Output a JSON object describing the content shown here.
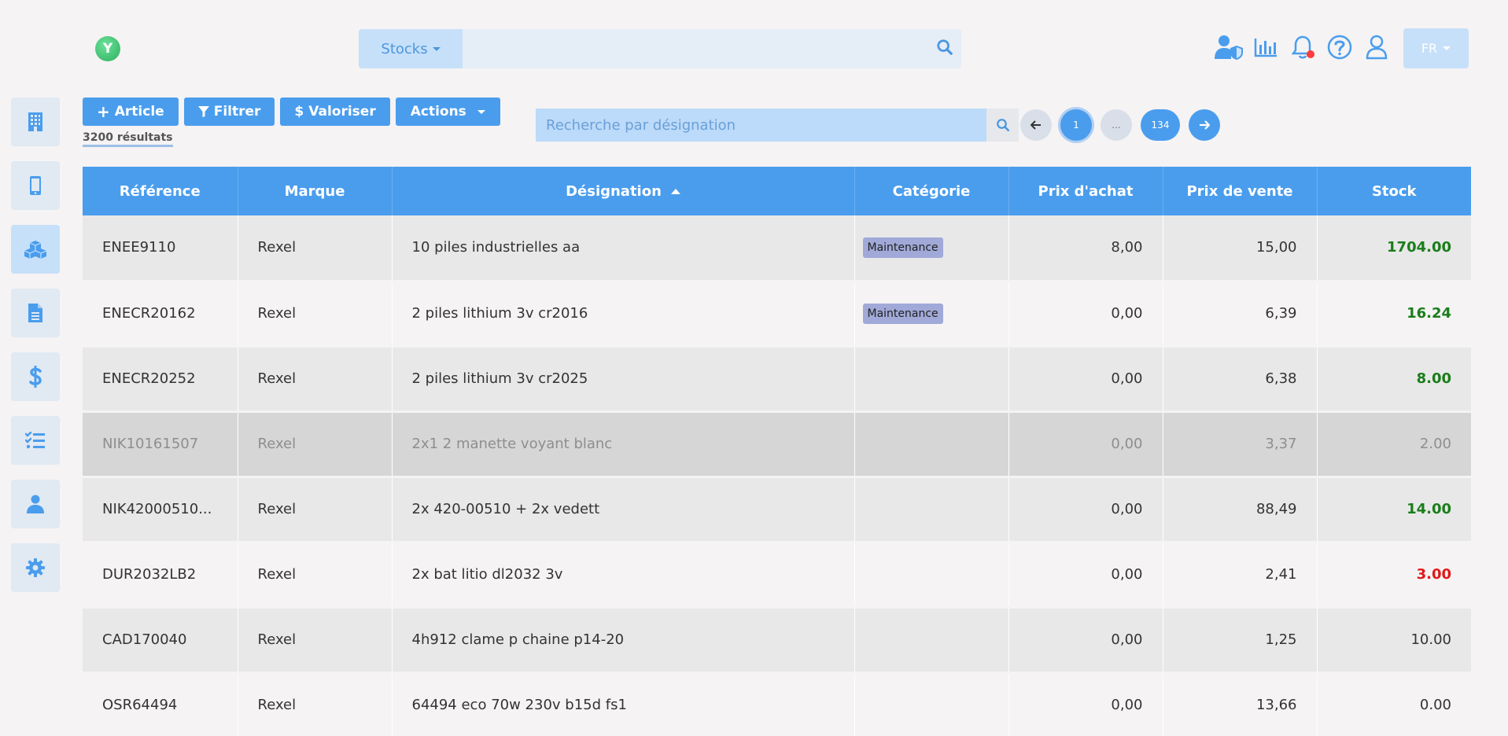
{
  "header": {
    "logo_letter": "Y",
    "module_select": "Stocks",
    "lang": "FR"
  },
  "toolbar": {
    "article_label": "Article",
    "filter_label": "Filtrer",
    "valorize_label": "Valoriser",
    "actions_label": "Actions",
    "results": "3200 résultats"
  },
  "search": {
    "placeholder": "Recherche par désignation"
  },
  "pagination": {
    "current": "1",
    "ellipsis": "...",
    "last": "134"
  },
  "table": {
    "headers": {
      "reference": "Référence",
      "brand": "Marque",
      "designation": "Désignation",
      "category": "Catégorie",
      "purchase_price": "Prix d'achat",
      "sale_price": "Prix de vente",
      "stock": "Stock"
    },
    "rows": [
      {
        "ref": "ENEE9110",
        "brand": "Rexel",
        "designation": "10 piles industrielles aa",
        "category": "Maintenance",
        "purchase": "8,00",
        "sale": "15,00",
        "stock": "1704.00"
      },
      {
        "ref": "ENECR20162",
        "brand": "Rexel",
        "designation": "2 piles lithium 3v cr2016",
        "category": "Maintenance",
        "purchase": "0,00",
        "sale": "6,39",
        "stock": "16.24"
      },
      {
        "ref": "ENECR20252",
        "brand": "Rexel",
        "designation": "2 piles lithium 3v cr2025",
        "category": "",
        "purchase": "0,00",
        "sale": "6,38",
        "stock": "8.00"
      },
      {
        "ref": "NIK10161507",
        "brand": "Rexel",
        "designation": "2x1 2 manette voyant blanc",
        "category": "",
        "purchase": "0,00",
        "sale": "3,37",
        "stock": "2.00"
      },
      {
        "ref": "NIK42000510...",
        "brand": "Rexel",
        "designation": "2x 420-00510 + 2x vedett",
        "category": "",
        "purchase": "0,00",
        "sale": "88,49",
        "stock": "14.00"
      },
      {
        "ref": "DUR2032LB2",
        "brand": "Rexel",
        "designation": "2x bat litio dl2032 3v",
        "category": "",
        "purchase": "0,00",
        "sale": "2,41",
        "stock": "3.00"
      },
      {
        "ref": "CAD170040",
        "brand": "Rexel",
        "designation": "4h912 clame p chaine p14-20",
        "category": "",
        "purchase": "0,00",
        "sale": "1,25",
        "stock": "10.00"
      },
      {
        "ref": "OSR64494",
        "brand": "Rexel",
        "designation": "64494 eco 70w 230v b15d fs1",
        "category": "",
        "purchase": "0,00",
        "sale": "13,66",
        "stock": "0.00"
      }
    ]
  },
  "colors": {
    "accent": "#4a9ded",
    "stock_ok": "#1a7d1a",
    "stock_low": "#e01818"
  },
  "icons": {
    "sidebar": [
      "building-icon",
      "mobile-icon",
      "cubes-icon",
      "document-icon",
      "dollar-icon",
      "checklist-icon",
      "user-icon",
      "gear-icon"
    ],
    "top": [
      "user-shield-icon",
      "chart-bar-icon",
      "bell-icon",
      "help-circle-icon",
      "user-outline-icon"
    ]
  }
}
